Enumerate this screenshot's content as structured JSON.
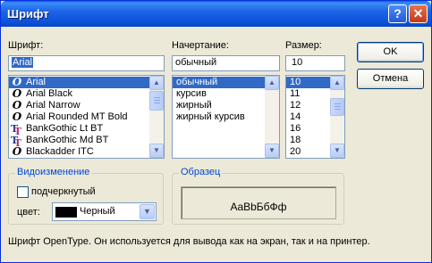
{
  "window": {
    "title": "Шрифт",
    "help_glyph": "?",
    "close_glyph": "✕"
  },
  "font": {
    "label": "Шрифт:",
    "value": "Arial",
    "items": [
      {
        "name": "Arial",
        "icon": "opentype-icon",
        "selected": true
      },
      {
        "name": "Arial Black",
        "icon": "opentype-icon",
        "selected": false
      },
      {
        "name": "Arial Narrow",
        "icon": "opentype-icon",
        "selected": false
      },
      {
        "name": "Arial Rounded MT Bold",
        "icon": "opentype-icon",
        "selected": false
      },
      {
        "name": "BankGothic Lt BT",
        "icon": "truetype-icon",
        "selected": false
      },
      {
        "name": "BankGothic Md BT",
        "icon": "truetype-icon",
        "selected": false
      },
      {
        "name": "Blackadder ITC",
        "icon": "opentype-icon",
        "selected": false
      }
    ]
  },
  "style": {
    "label": "Начертание:",
    "value": "обычный",
    "items": [
      {
        "name": "обычный",
        "selected": true
      },
      {
        "name": "курсив",
        "selected": false
      },
      {
        "name": "жирный",
        "selected": false
      },
      {
        "name": "жирный курсив",
        "selected": false
      }
    ]
  },
  "size": {
    "label": "Размер:",
    "value": "10",
    "items": [
      {
        "name": "10",
        "selected": true
      },
      {
        "name": "11",
        "selected": false
      },
      {
        "name": "12",
        "selected": false
      },
      {
        "name": "14",
        "selected": false
      },
      {
        "name": "16",
        "selected": false
      },
      {
        "name": "18",
        "selected": false
      },
      {
        "name": "20",
        "selected": false
      }
    ]
  },
  "buttons": {
    "ok": "OK",
    "cancel": "Отмена"
  },
  "effects": {
    "title": "Видоизменение",
    "underline_label": "подчеркнутый",
    "underline_checked": false,
    "color_label": "цвет:",
    "color_value": "Черный",
    "color_swatch": "#000000"
  },
  "sample": {
    "title": "Образец",
    "text": "AaBbБбФф"
  },
  "description": "Шрифт OpenType. Он используется для вывода как на экран, так и на принтер.",
  "icons": {
    "opentype": "O",
    "truetype_t1": "T",
    "truetype_t2": "T",
    "scroll_up": "▲",
    "scroll_down": "▼",
    "combo_arrow": "▼"
  }
}
